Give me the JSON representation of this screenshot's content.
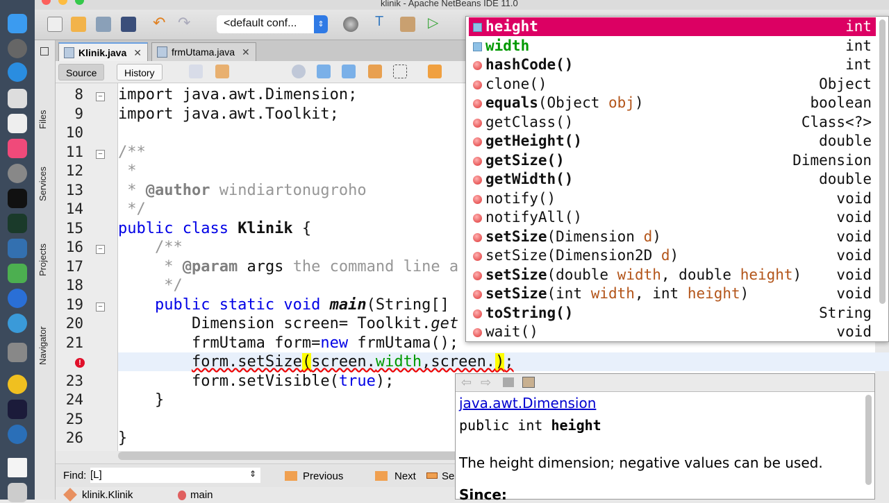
{
  "window": {
    "title": "klinik - Apache NetBeans IDE 11.0"
  },
  "toolbar": {
    "config": "<default conf...",
    "config_arrow": "⇕"
  },
  "side_panels": [
    "Files",
    "Services",
    "Projects",
    "Navigator"
  ],
  "tabs": [
    {
      "label": "Klinik.java",
      "active": true
    },
    {
      "label": "frmUtama.java",
      "active": false
    }
  ],
  "close_glyph": "✕",
  "editor_toolbar": {
    "source": "Source",
    "history": "History"
  },
  "code": [
    {
      "n": "8",
      "fold": "-",
      "seg": [
        {
          "t": "import java.awt.Dimension;",
          "c": ""
        }
      ]
    },
    {
      "n": "9",
      "seg": [
        {
          "t": "import java.awt.Toolkit;",
          "c": ""
        }
      ]
    },
    {
      "n": "10",
      "seg": []
    },
    {
      "n": "11",
      "fold": "-",
      "seg": [
        {
          "t": "/**",
          "c": "cm"
        }
      ]
    },
    {
      "n": "12",
      "seg": [
        {
          "t": " *",
          "c": "cm"
        }
      ]
    },
    {
      "n": "13",
      "seg": [
        {
          "t": " * ",
          "c": "cm"
        },
        {
          "t": "@author",
          "c": "tag"
        },
        {
          "t": " windiartonugroho",
          "c": "cm"
        }
      ]
    },
    {
      "n": "14",
      "seg": [
        {
          "t": " */",
          "c": "cm"
        }
      ]
    },
    {
      "n": "15",
      "seg": [
        {
          "t": "public class ",
          "c": "kw"
        },
        {
          "t": "Klinik",
          "c": "bold"
        },
        {
          "t": " {",
          "c": ""
        }
      ]
    },
    {
      "n": "16",
      "fold": "-",
      "seg": [
        {
          "t": "    /**",
          "c": "cm"
        }
      ]
    },
    {
      "n": "17",
      "seg": [
        {
          "t": "     * ",
          "c": "cm"
        },
        {
          "t": "@param",
          "c": "tag"
        },
        {
          "t": " args ",
          "c": ""
        },
        {
          "t": "the command line a",
          "c": "cm"
        }
      ]
    },
    {
      "n": "18",
      "seg": [
        {
          "t": "     */",
          "c": "cm"
        }
      ]
    },
    {
      "n": "19",
      "fold": "-",
      "seg": [
        {
          "t": "    public static void ",
          "c": "kw"
        },
        {
          "t": "main",
          "c": "it bold"
        },
        {
          "t": "(String[]",
          "c": ""
        }
      ]
    },
    {
      "n": "20",
      "seg": [
        {
          "t": "        Dimension screen= Toolkit.",
          "c": ""
        },
        {
          "t": "get",
          "c": "it"
        }
      ]
    },
    {
      "n": "21",
      "seg": [
        {
          "t": "        frmUtama form=",
          "c": ""
        },
        {
          "t": "new",
          "c": "kw"
        },
        {
          "t": " frmUtama();",
          "c": ""
        }
      ]
    },
    {
      "n": "",
      "error": true,
      "seg": [
        {
          "t": "        ",
          "c": ""
        },
        {
          "t": "form.setSize",
          "c": "err"
        },
        {
          "t": "(",
          "c": "err hl"
        },
        {
          "t": "screen.",
          "c": "err"
        },
        {
          "t": "width",
          "c": "err fld"
        },
        {
          "t": ",screen.",
          "c": "err"
        },
        {
          "t": ")",
          "c": "err hl"
        },
        {
          "t": ";",
          "c": "err"
        }
      ]
    },
    {
      "n": "23",
      "seg": [
        {
          "t": "        form.setVisible(",
          "c": ""
        },
        {
          "t": "true",
          "c": "kw"
        },
        {
          "t": ");",
          "c": ""
        }
      ]
    },
    {
      "n": "24",
      "seg": [
        {
          "t": "    }",
          "c": ""
        }
      ]
    },
    {
      "n": "25",
      "seg": []
    },
    {
      "n": "26",
      "seg": [
        {
          "t": "}",
          "c": ""
        }
      ]
    }
  ],
  "completion": [
    {
      "kind": "field",
      "name": [
        {
          "t": "height",
          "c": "bold"
        }
      ],
      "type": "int",
      "selected": true
    },
    {
      "kind": "field",
      "name": [
        {
          "t": "width",
          "c": "bold fld"
        }
      ],
      "type": "int"
    },
    {
      "kind": "method",
      "name": [
        {
          "t": "hashCode()",
          "c": "bold"
        }
      ],
      "type": "int"
    },
    {
      "kind": "method",
      "name": [
        {
          "t": "clone()",
          "c": ""
        }
      ],
      "type": "Object"
    },
    {
      "kind": "method",
      "name": [
        {
          "t": "equals",
          "c": "bold"
        },
        {
          "t": "(Object ",
          "c": ""
        },
        {
          "t": "obj",
          "c": "pm"
        },
        {
          "t": ")",
          "c": ""
        }
      ],
      "type": "boolean"
    },
    {
      "kind": "method",
      "name": [
        {
          "t": "getClass()",
          "c": ""
        }
      ],
      "type": "Class<?>"
    },
    {
      "kind": "method",
      "name": [
        {
          "t": "getHeight()",
          "c": "bold"
        }
      ],
      "type": "double"
    },
    {
      "kind": "method",
      "name": [
        {
          "t": "getSize()",
          "c": "bold"
        }
      ],
      "type": "Dimension"
    },
    {
      "kind": "method",
      "name": [
        {
          "t": "getWidth()",
          "c": "bold"
        }
      ],
      "type": "double"
    },
    {
      "kind": "method",
      "name": [
        {
          "t": "notify()",
          "c": ""
        }
      ],
      "type": "void"
    },
    {
      "kind": "method",
      "name": [
        {
          "t": "notifyAll()",
          "c": ""
        }
      ],
      "type": "void"
    },
    {
      "kind": "method",
      "name": [
        {
          "t": "setSize",
          "c": "bold"
        },
        {
          "t": "(Dimension ",
          "c": ""
        },
        {
          "t": "d",
          "c": "pm"
        },
        {
          "t": ")",
          "c": ""
        }
      ],
      "type": "void"
    },
    {
      "kind": "method",
      "name": [
        {
          "t": "setSize",
          "c": ""
        },
        {
          "t": "(Dimension2D ",
          "c": ""
        },
        {
          "t": "d",
          "c": "pm"
        },
        {
          "t": ")",
          "c": ""
        }
      ],
      "type": "void"
    },
    {
      "kind": "method",
      "name": [
        {
          "t": "setSize",
          "c": "bold"
        },
        {
          "t": "(double ",
          "c": ""
        },
        {
          "t": "width",
          "c": "pm"
        },
        {
          "t": ", double ",
          "c": ""
        },
        {
          "t": "height",
          "c": "pm"
        },
        {
          "t": ")",
          "c": ""
        }
      ],
      "type": "void"
    },
    {
      "kind": "method",
      "name": [
        {
          "t": "setSize",
          "c": "bold"
        },
        {
          "t": "(int ",
          "c": ""
        },
        {
          "t": "width",
          "c": "pm"
        },
        {
          "t": ", int ",
          "c": ""
        },
        {
          "t": "height",
          "c": "pm"
        },
        {
          "t": ")",
          "c": ""
        }
      ],
      "type": "void"
    },
    {
      "kind": "method",
      "name": [
        {
          "t": "toString()",
          "c": "bold"
        }
      ],
      "type": "String"
    },
    {
      "kind": "method",
      "name": [
        {
          "t": "wait()",
          "c": ""
        }
      ],
      "type": "void"
    }
  ],
  "javadoc": {
    "class_link": "java.awt.Dimension",
    "decl_prefix": "public int ",
    "decl_name": "height",
    "description": "The height dimension; negative values can be used.",
    "since": "Since:"
  },
  "find": {
    "label": "Find:",
    "value": "[L]",
    "previous": "Previous",
    "next": "Next",
    "select": "Sel"
  },
  "breadcrumb": [
    "klinik.Klinik",
    "main"
  ],
  "colors": {
    "selection": "#dc0063",
    "keyword": "#0000e6",
    "field": "#009900",
    "comment": "#969696"
  }
}
